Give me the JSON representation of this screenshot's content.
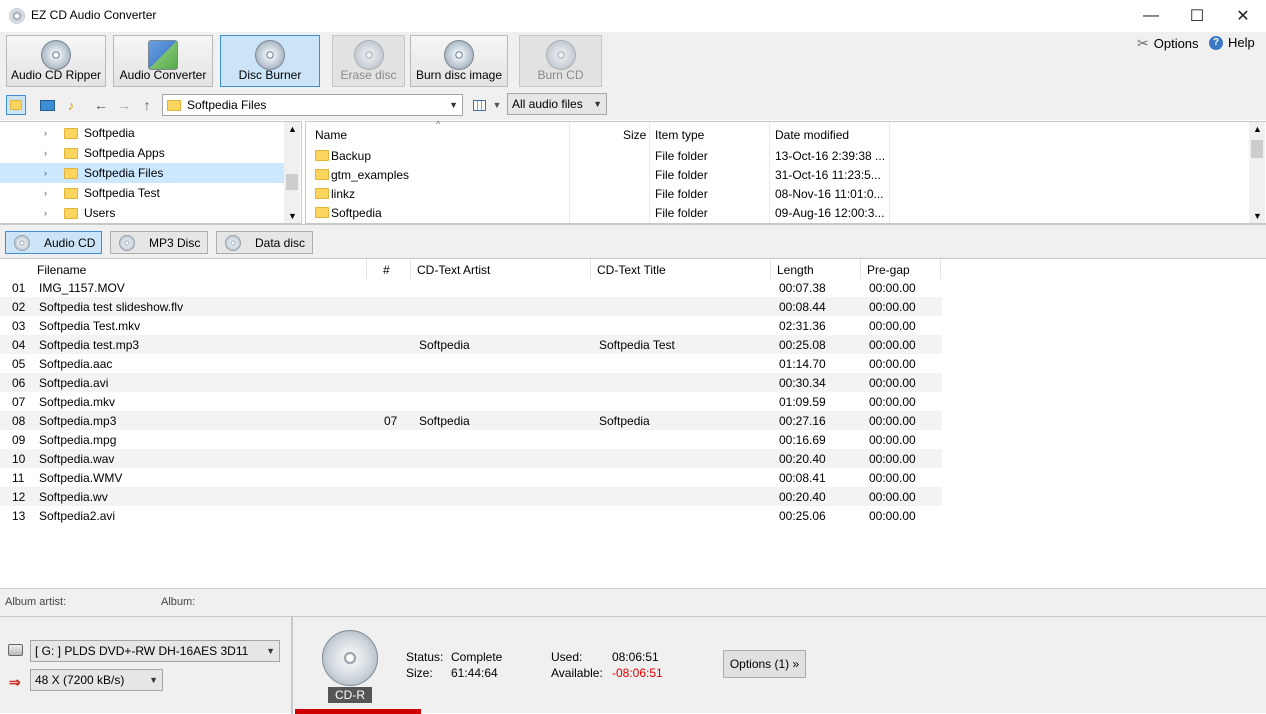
{
  "window": {
    "title": "EZ CD Audio Converter",
    "minimize": "—",
    "maximize": "☐",
    "close": "✕"
  },
  "ribbon": {
    "buttons": [
      {
        "label": "Audio CD Ripper"
      },
      {
        "label": "Audio Converter"
      },
      {
        "label": "Disc Burner"
      },
      {
        "label": "Erase disc"
      },
      {
        "label": "Burn disc image"
      },
      {
        "label": "Burn CD"
      }
    ],
    "options_label": "Options",
    "help_label": "Help"
  },
  "toolbar": {
    "path": "Softpedia Files",
    "filter": "All audio files",
    "back_icon": "←",
    "forward_icon": "→",
    "up_icon": "↑"
  },
  "tree": {
    "items": [
      {
        "label": "Softpedia"
      },
      {
        "label": "Softpedia Apps"
      },
      {
        "label": "Softpedia Files"
      },
      {
        "label": "Softpedia Test"
      },
      {
        "label": "Users"
      }
    ]
  },
  "files": {
    "headers": {
      "name": "Name",
      "size": "Size",
      "type": "Item type",
      "date": "Date modified"
    },
    "rows": [
      {
        "name": "Backup",
        "size": "",
        "type": "File folder",
        "date": "13-Oct-16 2:39:38 ..."
      },
      {
        "name": "gtm_examples",
        "size": "",
        "type": "File folder",
        "date": "31-Oct-16 11:23:5..."
      },
      {
        "name": "linkz",
        "size": "",
        "type": "File folder",
        "date": "08-Nov-16 11:01:0..."
      },
      {
        "name": "Softpedia",
        "size": "",
        "type": "File folder",
        "date": "09-Aug-16 12:00:3..."
      }
    ]
  },
  "disc_tabs": [
    {
      "label": "Audio CD"
    },
    {
      "label": "MP3 Disc"
    },
    {
      "label": "Data disc"
    }
  ],
  "tracks": {
    "headers": {
      "filename": "Filename",
      "num": "#",
      "artist": "CD-Text Artist",
      "title": "CD-Text Title",
      "length": "Length",
      "pregap": "Pre-gap"
    },
    "rows": [
      {
        "idx": "01",
        "filename": "IMG_1157.MOV",
        "num": "",
        "artist": "",
        "title": "",
        "length": "00:07.38",
        "pregap": "00:00.00"
      },
      {
        "idx": "02",
        "filename": "Softpedia test slideshow.flv",
        "num": "",
        "artist": "",
        "title": "",
        "length": "00:08.44",
        "pregap": "00:00.00"
      },
      {
        "idx": "03",
        "filename": "Softpedia Test.mkv",
        "num": "",
        "artist": "",
        "title": "",
        "length": "02:31.36",
        "pregap": "00:00.00"
      },
      {
        "idx": "04",
        "filename": "Softpedia test.mp3",
        "num": "",
        "artist": "Softpedia",
        "title": "Softpedia Test",
        "length": "00:25.08",
        "pregap": "00:00.00"
      },
      {
        "idx": "05",
        "filename": "Softpedia.aac",
        "num": "",
        "artist": "",
        "title": "",
        "length": "01:14.70",
        "pregap": "00:00.00"
      },
      {
        "idx": "06",
        "filename": "Softpedia.avi",
        "num": "",
        "artist": "",
        "title": "",
        "length": "00:30.34",
        "pregap": "00:00.00"
      },
      {
        "idx": "07",
        "filename": "Softpedia.mkv",
        "num": "",
        "artist": "",
        "title": "",
        "length": "01:09.59",
        "pregap": "00:00.00"
      },
      {
        "idx": "08",
        "filename": "Softpedia.mp3",
        "num": "07",
        "artist": "Softpedia",
        "title": "Softpedia",
        "length": "00:27.16",
        "pregap": "00:00.00"
      },
      {
        "idx": "09",
        "filename": "Softpedia.mpg",
        "num": "",
        "artist": "",
        "title": "",
        "length": "00:16.69",
        "pregap": "00:00.00"
      },
      {
        "idx": "10",
        "filename": "Softpedia.wav",
        "num": "",
        "artist": "",
        "title": "",
        "length": "00:20.40",
        "pregap": "00:00.00"
      },
      {
        "idx": "11",
        "filename": "Softpedia.WMV",
        "num": "",
        "artist": "",
        "title": "",
        "length": "00:08.41",
        "pregap": "00:00.00"
      },
      {
        "idx": "12",
        "filename": "Softpedia.wv",
        "num": "",
        "artist": "",
        "title": "",
        "length": "00:20.40",
        "pregap": "00:00.00"
      },
      {
        "idx": "13",
        "filename": "Softpedia2.avi",
        "num": "",
        "artist": "",
        "title": "",
        "length": "00:25.06",
        "pregap": "00:00.00"
      }
    ]
  },
  "album": {
    "artist_label": "Album artist:",
    "album_label": "Album:"
  },
  "drive": {
    "device": "[ G: ] PLDS DVD+-RW DH-16AES 3D11",
    "speed": "48 X (7200 kB/s)"
  },
  "disc_info": {
    "media": "CD-R",
    "status_label": "Status:",
    "status": "Complete",
    "size_label": "Size:",
    "size": "61:44:64",
    "used_label": "Used:",
    "used": "08:06:51",
    "available_label": "Available:",
    "available": "-08:06:51",
    "options_button": "Options (1) »",
    "available_color": "#e00000",
    "progress_color": "#d00000"
  }
}
